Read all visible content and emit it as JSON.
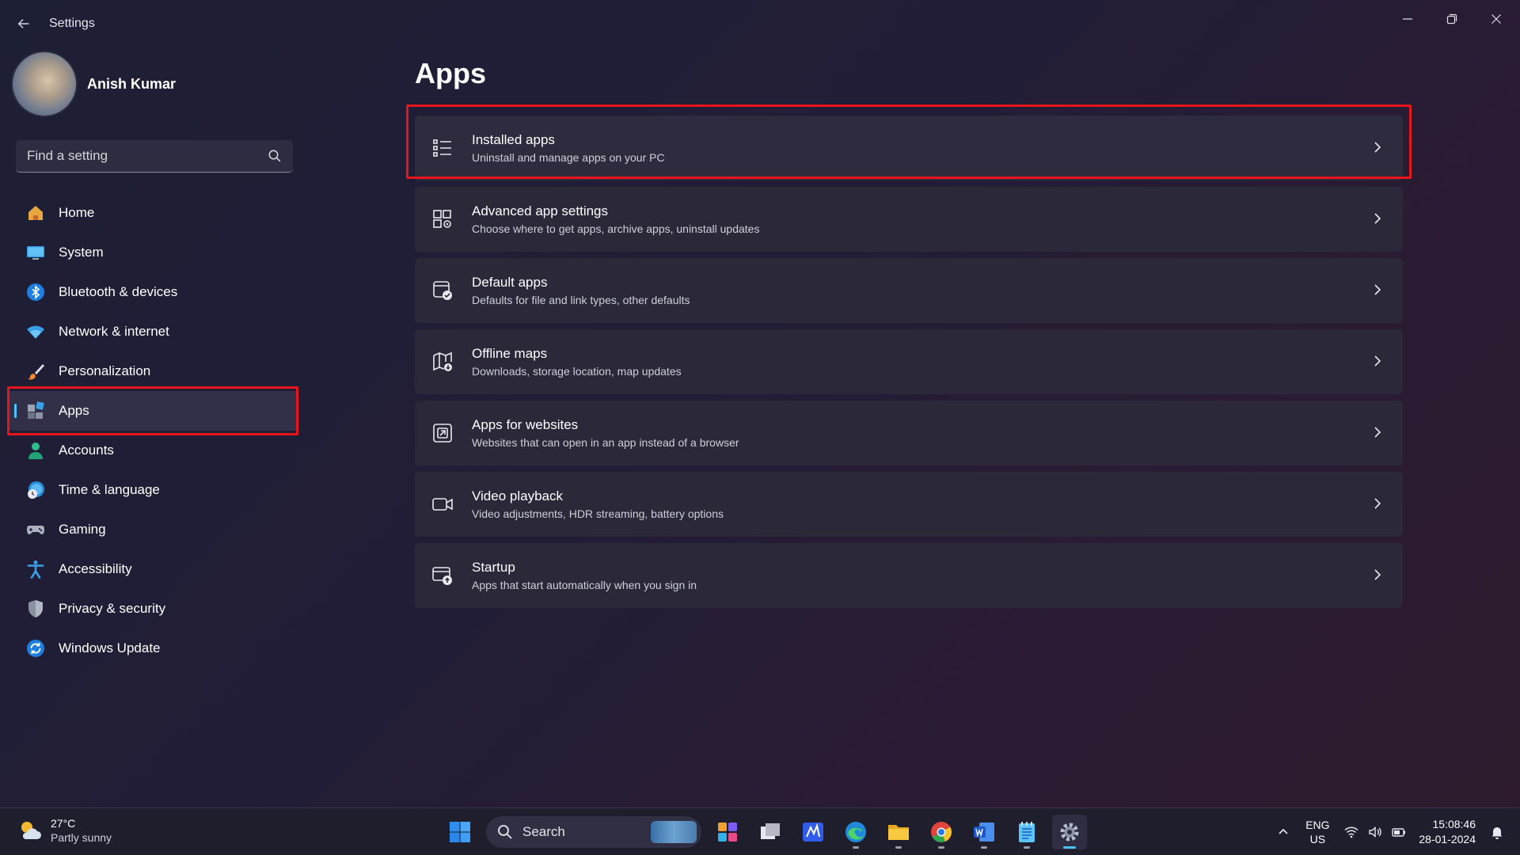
{
  "window": {
    "title": "Settings"
  },
  "profile": {
    "name": "Anish Kumar"
  },
  "search": {
    "placeholder": "Find a setting"
  },
  "nav": {
    "items": [
      {
        "label": "Home",
        "icon": "home-icon"
      },
      {
        "label": "System",
        "icon": "system-icon"
      },
      {
        "label": "Bluetooth & devices",
        "icon": "bluetooth-icon"
      },
      {
        "label": "Network & internet",
        "icon": "wifi-icon"
      },
      {
        "label": "Personalization",
        "icon": "brush-icon"
      },
      {
        "label": "Apps",
        "icon": "apps-icon",
        "selected": true
      },
      {
        "label": "Accounts",
        "icon": "accounts-icon"
      },
      {
        "label": "Time & language",
        "icon": "globe-clock-icon"
      },
      {
        "label": "Gaming",
        "icon": "gamepad-icon"
      },
      {
        "label": "Accessibility",
        "icon": "accessibility-icon"
      },
      {
        "label": "Privacy & security",
        "icon": "shield-icon"
      },
      {
        "label": "Windows Update",
        "icon": "update-icon"
      }
    ]
  },
  "main": {
    "heading": "Apps",
    "cards": [
      {
        "title": "Installed apps",
        "subtitle": "Uninstall and manage apps on your PC",
        "icon": "list-icon"
      },
      {
        "title": "Advanced app settings",
        "subtitle": "Choose where to get apps, archive apps, uninstall updates",
        "icon": "app-settings-icon"
      },
      {
        "title": "Default apps",
        "subtitle": "Defaults for file and link types, other defaults",
        "icon": "default-apps-icon"
      },
      {
        "title": "Offline maps",
        "subtitle": "Downloads, storage location, map updates",
        "icon": "map-icon"
      },
      {
        "title": "Apps for websites",
        "subtitle": "Websites that can open in an app instead of a browser",
        "icon": "open-in-app-icon"
      },
      {
        "title": "Video playback",
        "subtitle": "Video adjustments, HDR streaming, battery options",
        "icon": "video-icon"
      },
      {
        "title": "Startup",
        "subtitle": "Apps that start automatically when you sign in",
        "icon": "startup-icon"
      }
    ]
  },
  "taskbar": {
    "weather": {
      "temp": "27°C",
      "desc": "Partly sunny"
    },
    "search_label": "Search",
    "language": {
      "line1": "ENG",
      "line2": "US"
    },
    "clock": {
      "time": "15:08:46",
      "date": "28-01-2024"
    }
  },
  "colors": {
    "accent": "#4cc2ff",
    "highlight": "#e8141c"
  }
}
